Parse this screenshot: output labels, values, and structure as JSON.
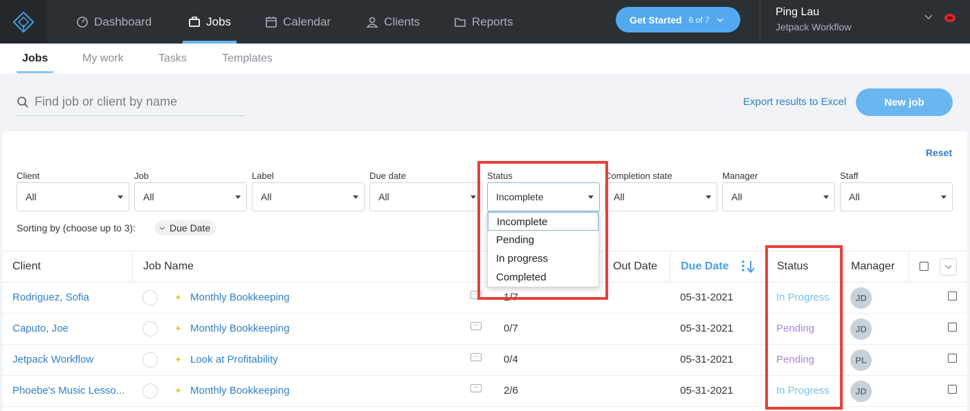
{
  "nav": {
    "items": [
      {
        "label": "Dashboard",
        "icon": "dashboard-gauge-icon"
      },
      {
        "label": "Jobs",
        "icon": "jobs-briefcase-icon",
        "active": true
      },
      {
        "label": "Calendar",
        "icon": "calendar-icon"
      },
      {
        "label": "Clients",
        "icon": "clients-person-icon"
      },
      {
        "label": "Reports",
        "icon": "reports-folder-icon"
      }
    ],
    "get_started": {
      "label": "Get Started",
      "progress": "6 of 7"
    },
    "user": {
      "name": "Ping Lau",
      "company": "Jetpack Workflow"
    }
  },
  "subtabs": [
    {
      "label": "Jobs",
      "active": true
    },
    {
      "label": "My work"
    },
    {
      "label": "Tasks"
    },
    {
      "label": "Templates"
    }
  ],
  "search": {
    "placeholder": "Find job or client by name",
    "value": ""
  },
  "actions": {
    "export": "Export results to Excel",
    "new_job": "New job"
  },
  "filters": {
    "reset": "Reset",
    "items": [
      {
        "label": "Client",
        "value": "All"
      },
      {
        "label": "Job",
        "value": "All"
      },
      {
        "label": "Label",
        "value": "All"
      },
      {
        "label": "Due date",
        "value": "All"
      },
      {
        "label": "Status",
        "value": "Incomplete"
      },
      {
        "label": "Completion state",
        "value": "All"
      },
      {
        "label": "Manager",
        "value": "All"
      },
      {
        "label": "Staff",
        "value": "All"
      }
    ],
    "status_options": [
      "Incomplete",
      "Pending",
      "In progress",
      "Completed"
    ],
    "sort_label": "Sorting by (choose up to 3):",
    "sort_chip": "Due Date"
  },
  "table": {
    "headers": {
      "client": "Client",
      "job_name": "Job Name",
      "out_date": "Out Date",
      "due_date": "Due Date",
      "status": "Status",
      "manager": "Manager"
    },
    "rows": [
      {
        "client": "Rodriguez, Sofia",
        "job": "Monthly Bookkeeping",
        "progress": "1/7",
        "due": "05-31-2021",
        "status": "In Progress",
        "manager": "JD"
      },
      {
        "client": "Caputo, Joe",
        "job": "Monthly Bookkeeping",
        "progress": "0/7",
        "due": "05-31-2021",
        "status": "Pending",
        "manager": "JD"
      },
      {
        "client": "Jetpack Workflow",
        "job": "Look at Profitability",
        "progress": "0/4",
        "due": "05-31-2021",
        "status": "Pending",
        "manager": "PL"
      },
      {
        "client": "Phoebe's Music Lesso...",
        "job": "Monthly Bookkeeping",
        "progress": "2/6",
        "due": "05-31-2021",
        "status": "In Progress",
        "manager": "JD"
      }
    ]
  },
  "colors": {
    "accent": "#52a9f0",
    "highlight": "#e8403a",
    "in_progress": "#74bfee",
    "pending": "#a886e0"
  }
}
